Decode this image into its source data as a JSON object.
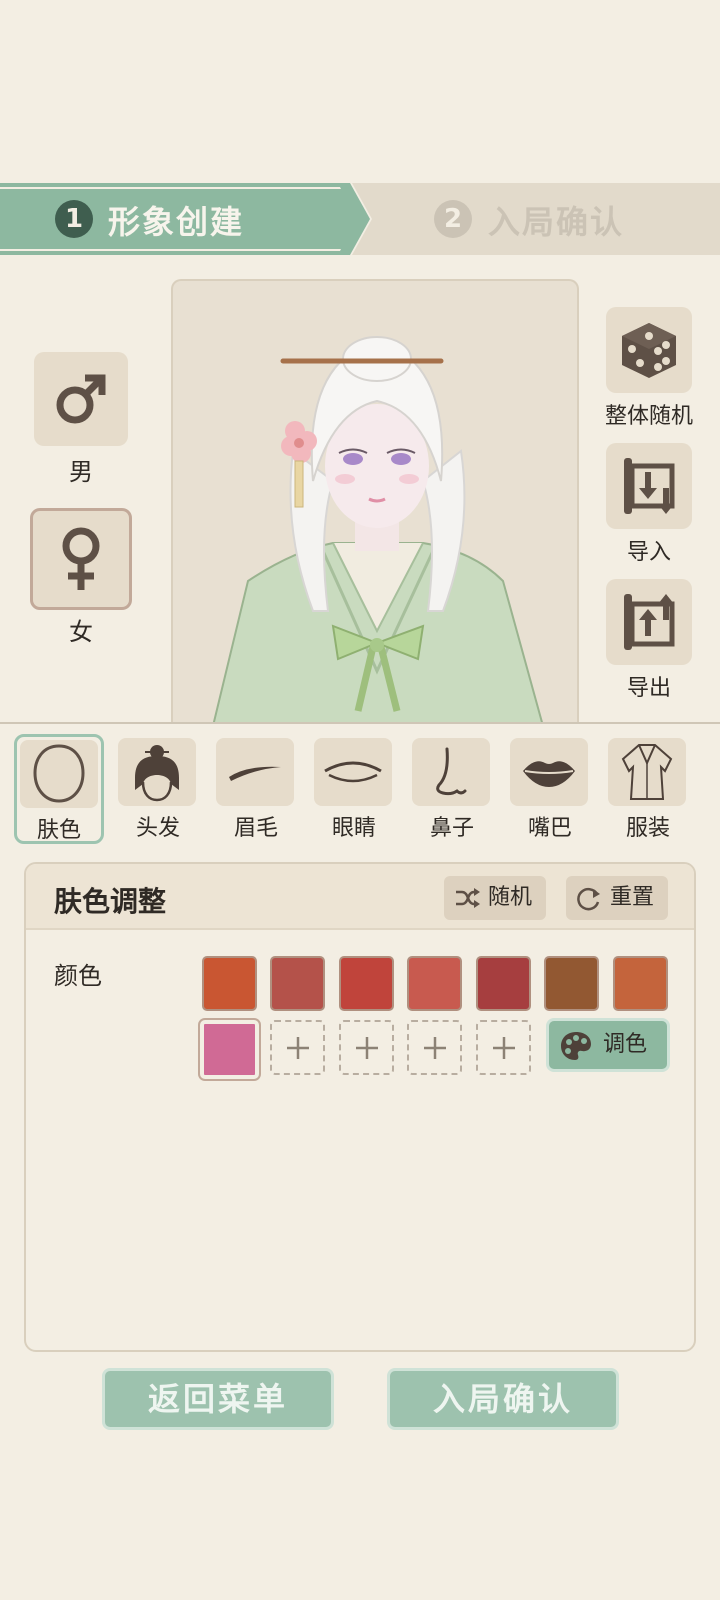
{
  "steps": [
    {
      "num": "1",
      "label": "形象创建",
      "active": true
    },
    {
      "num": "2",
      "label": "入局确认",
      "active": false
    }
  ],
  "gender": {
    "male": {
      "label": "男",
      "icon": "male-symbol-icon"
    },
    "female": {
      "label": "女",
      "icon": "female-symbol-icon",
      "selected": true
    }
  },
  "side_actions": [
    {
      "label": "整体随机",
      "icon": "dice-icon"
    },
    {
      "label": "导入",
      "icon": "import-scroll-icon"
    },
    {
      "label": "导出",
      "icon": "export-scroll-icon"
    }
  ],
  "feature_tabs": [
    {
      "label": "肤色",
      "icon": "face-outline-icon",
      "active": true
    },
    {
      "label": "头发",
      "icon": "hair-bun-icon"
    },
    {
      "label": "眉毛",
      "icon": "eyebrow-icon"
    },
    {
      "label": "眼睛",
      "icon": "eye-icon"
    },
    {
      "label": "鼻子",
      "icon": "nose-icon"
    },
    {
      "label": "嘴巴",
      "icon": "lips-icon"
    },
    {
      "label": "服装",
      "icon": "robe-icon"
    }
  ],
  "panel": {
    "title": "肤色调整",
    "random_label": "随机",
    "reset_label": "重置",
    "color_label": "颜色",
    "palette_label": "调色",
    "swatches": [
      "#c95632",
      "#b4524a",
      "#c0443b",
      "#c85a4f",
      "#a63e3f",
      "#925832",
      "#c4643c"
    ],
    "selected_swatch": "#d06a95",
    "empty_slots": 4
  },
  "bottom": {
    "back_label": "返回菜单",
    "confirm_label": "入局确认"
  },
  "colors": {
    "accent": "#8db8a0",
    "background": "#f3eee3",
    "tile": "#e6dccb"
  }
}
